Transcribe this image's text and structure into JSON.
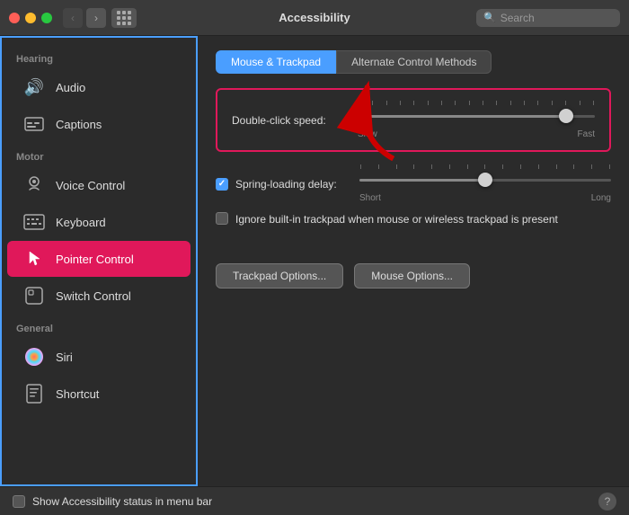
{
  "titlebar": {
    "title": "Accessibility",
    "search_placeholder": "Search",
    "back_btn": "‹",
    "forward_btn": "›"
  },
  "sidebar": {
    "sections": [
      {
        "label": "Hearing",
        "items": [
          {
            "id": "audio",
            "label": "Audio",
            "icon": "🔊"
          },
          {
            "id": "captions",
            "label": "Captions",
            "icon": "📋"
          }
        ]
      },
      {
        "label": "Motor",
        "items": [
          {
            "id": "voice-control",
            "label": "Voice Control",
            "icon": "🎙"
          },
          {
            "id": "keyboard",
            "label": "Keyboard",
            "icon": "⌨️"
          },
          {
            "id": "pointer-control",
            "label": "Pointer Control",
            "icon": "🖱",
            "active": true
          },
          {
            "id": "switch-control",
            "label": "Switch Control",
            "icon": "⬜"
          }
        ]
      },
      {
        "label": "General",
        "items": [
          {
            "id": "siri",
            "label": "Siri",
            "icon": "🌈"
          },
          {
            "id": "shortcut",
            "label": "Shortcut",
            "icon": "📱"
          }
        ]
      }
    ]
  },
  "content": {
    "tabs": [
      {
        "id": "mouse-trackpad",
        "label": "Mouse & Trackpad",
        "active": true
      },
      {
        "id": "alternate-control",
        "label": "Alternate Control Methods",
        "active": false
      }
    ],
    "double_click_label": "Double-click speed:",
    "slow_label": "Slow",
    "fast_label": "Fast",
    "spring_loading_label": "Spring-loading delay:",
    "short_label": "Short",
    "long_label": "Long",
    "ignore_trackpad_label": "Ignore built-in trackpad when mouse or wireless trackpad is present",
    "trackpad_btn": "Trackpad Options...",
    "mouse_btn": "Mouse Options...",
    "bottom_checkbox_label": "Show Accessibility status in menu bar",
    "help": "?"
  }
}
